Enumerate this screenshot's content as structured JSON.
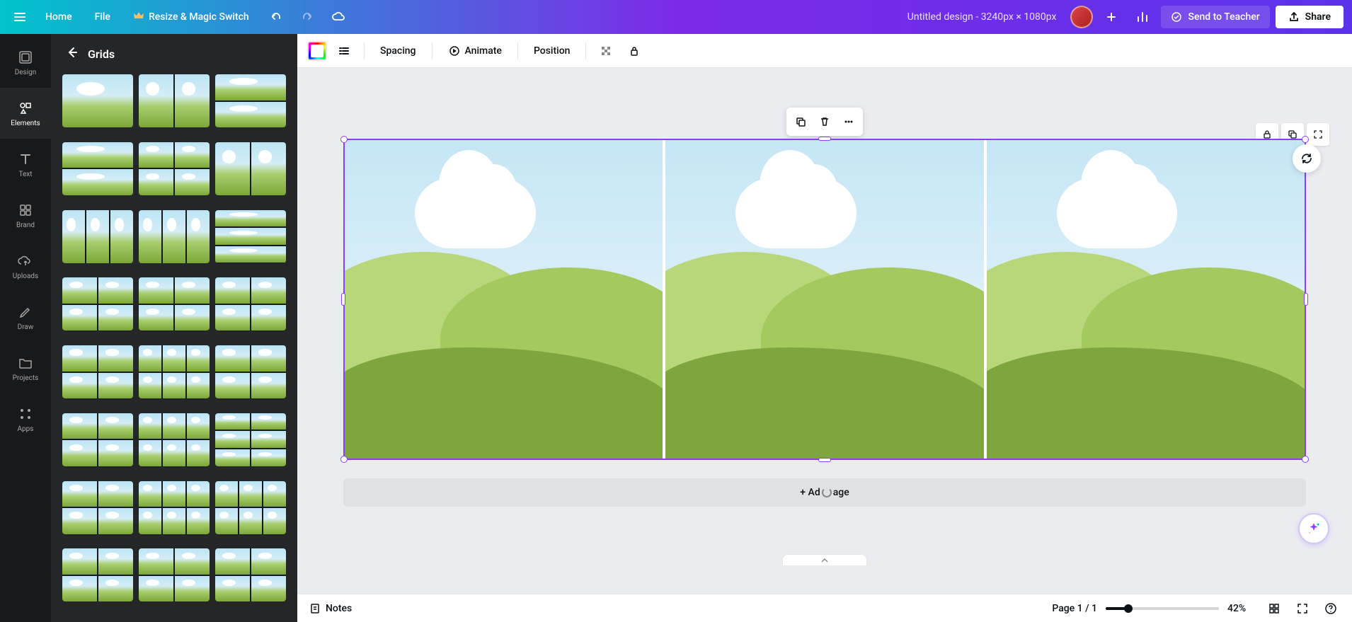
{
  "header": {
    "home": "Home",
    "file": "File",
    "resize": "Resize & Magic Switch",
    "design_title": "Untitled design - 3240px × 1080px",
    "send_to_teacher": "Send to Teacher",
    "share": "Share"
  },
  "left_rail": {
    "items": [
      {
        "label": "Design",
        "icon": "design"
      },
      {
        "label": "Elements",
        "icon": "elements"
      },
      {
        "label": "Text",
        "icon": "text"
      },
      {
        "label": "Brand",
        "icon": "brand"
      },
      {
        "label": "Uploads",
        "icon": "uploads"
      },
      {
        "label": "Draw",
        "icon": "draw"
      },
      {
        "label": "Projects",
        "icon": "projects"
      },
      {
        "label": "Apps",
        "icon": "apps"
      }
    ]
  },
  "side_panel": {
    "title": "Grids"
  },
  "context_toolbar": {
    "spacing": "Spacing",
    "animate": "Animate",
    "position": "Position"
  },
  "canvas": {
    "add_page": "+ Add page"
  },
  "bottom_bar": {
    "notes": "Notes",
    "page_indicator": "Page 1 / 1",
    "zoom": "42%"
  },
  "grid_layouts": [
    {
      "cols": 1,
      "rows": 1
    },
    {
      "cols": 2,
      "rows": 1
    },
    {
      "cols": 1,
      "rows": 2
    },
    {
      "cols": 1,
      "rows": 2
    },
    {
      "cols": 2,
      "rows": 2,
      "span": "tl"
    },
    {
      "cols": 2,
      "rows": 1
    },
    {
      "cols": 3,
      "rows": 1
    },
    {
      "cols": 3,
      "rows": 1
    },
    {
      "cols": 1,
      "rows": 3
    },
    {
      "cols": 2,
      "rows": 2
    },
    {
      "cols": 2,
      "rows": 2
    },
    {
      "cols": 2,
      "rows": 2
    },
    {
      "cols": 2,
      "rows": 2
    },
    {
      "cols": 3,
      "rows": 2
    },
    {
      "cols": 2,
      "rows": 2
    },
    {
      "cols": 2,
      "rows": 2
    },
    {
      "cols": 3,
      "rows": 2
    },
    {
      "cols": 2,
      "rows": 3
    },
    {
      "cols": 2,
      "rows": 2
    },
    {
      "cols": 3,
      "rows": 2
    },
    {
      "cols": 3,
      "rows": 2
    },
    {
      "cols": 2,
      "rows": 2
    },
    {
      "cols": 2,
      "rows": 2
    },
    {
      "cols": 2,
      "rows": 2
    }
  ]
}
